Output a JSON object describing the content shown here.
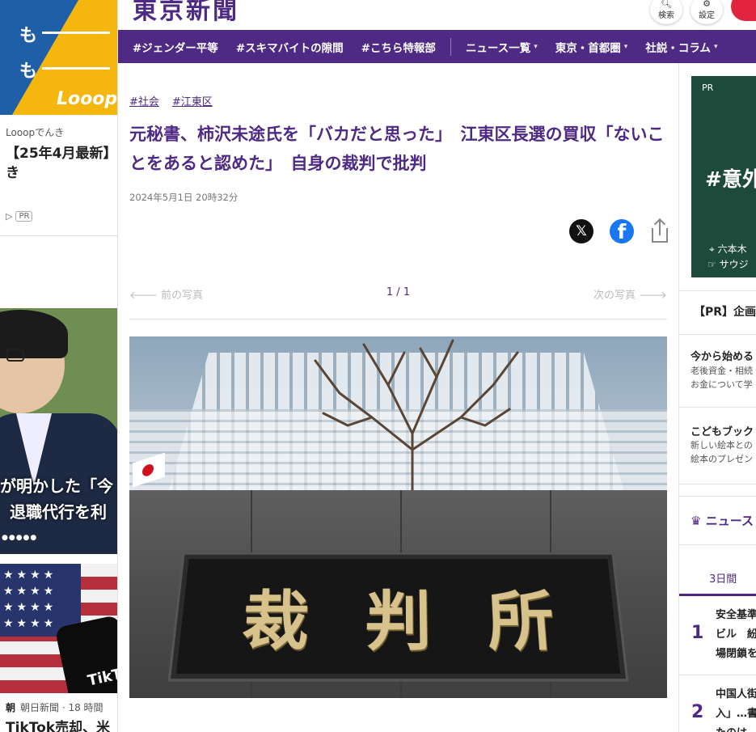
{
  "left_ads": {
    "ad1": {
      "line1": "も",
      "line2": "も",
      "logo": "Looop",
      "source": "Looopでんき",
      "title": "【25年4月最新】…き",
      "pr_badge": "PR"
    },
    "ad2": {
      "caption1": "が明かした「今",
      "caption2": "退職代行を利"
    },
    "ad3": {
      "brand": "TikTok"
    },
    "news": {
      "publisher_mark": "朝",
      "meta": "朝日新聞 · 18 時間",
      "title": "TikTok売却、米"
    }
  },
  "header": {
    "logo": "東京新聞",
    "search_label": "検索",
    "settings_label": "設定"
  },
  "nav": {
    "items": [
      {
        "label": "#ジェンダー平等"
      },
      {
        "label": "#スキマバイトの隙間"
      },
      {
        "label": "#こちら特報部"
      }
    ],
    "menus": [
      {
        "label": "ニュース一覧"
      },
      {
        "label": "東京・首都圏"
      },
      {
        "label": "社説・コラム"
      }
    ]
  },
  "article": {
    "tags": [
      "#社会",
      "#江東区"
    ],
    "headline": "元秘書、柿沢未途氏を「バカだと思った」　江東区長選の買収「ないことをあると認めた」　自身の裁判で批判",
    "date": "2024年5月1日 20時32分",
    "share": {
      "x": "𝕏",
      "facebook": "f"
    },
    "photo_nav": {
      "prev": "前の写真",
      "count": "1 / 1",
      "next": "次の写真"
    },
    "photo_plaque": [
      "裁",
      "判",
      "所"
    ]
  },
  "sidebar": {
    "ad": {
      "pr": "PR",
      "headline": "#意外",
      "location": "六本木",
      "sub": "サウジ"
    },
    "pr_section_title": "【PR】企画",
    "pr_items": [
      {
        "title": "今から始める",
        "desc1": "老後資金・相続",
        "desc2": "お金について学"
      },
      {
        "title": "こどもブック",
        "desc1": "新しい絵本との",
        "desc2": "絵本のプレゼン"
      }
    ],
    "ranking_title": "ニュース",
    "ranking_tab": "3日間",
    "ranking": [
      {
        "rank": "1",
        "line1": "安全基準",
        "line2": "ビル　紛",
        "line3": "場閉鎖を"
      },
      {
        "rank": "2",
        "line1": "中国人街",
        "line2": "入」…書",
        "line3": "たのは"
      }
    ]
  },
  "colors": {
    "brand_purple": "#4e2a84",
    "accent_red": "#e0243b",
    "facebook_blue": "#1877f2"
  }
}
